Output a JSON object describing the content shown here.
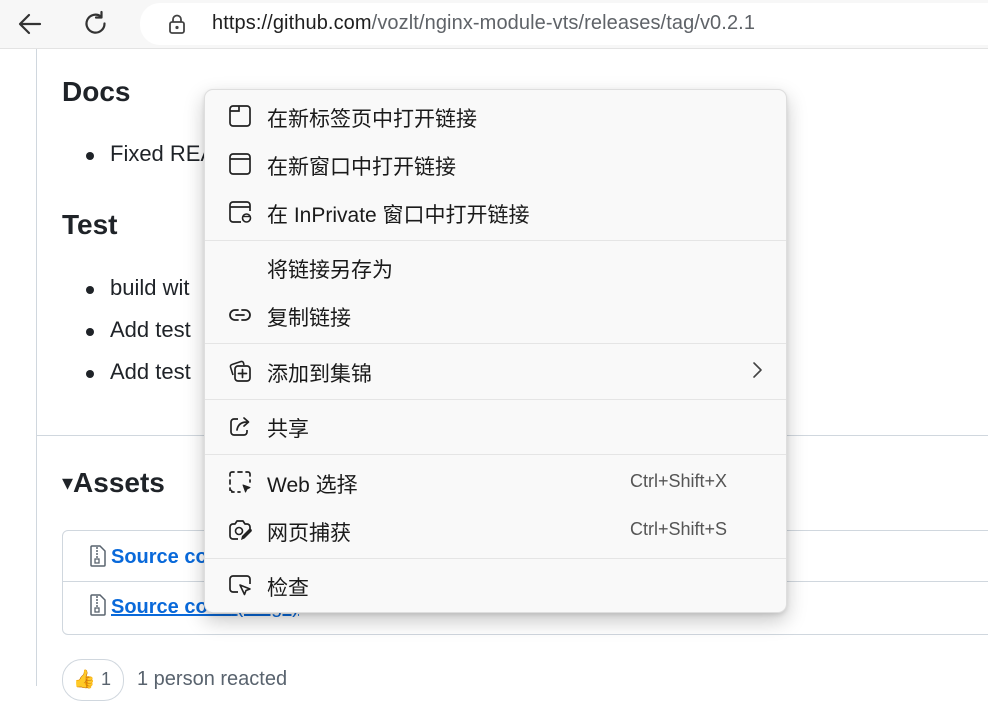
{
  "browser": {
    "url_host": "https://github.com",
    "url_path": "/vozlt/nginx-module-vts/releases/tag/v0.2.1"
  },
  "release": {
    "docs_heading": "Docs",
    "docs_items": [
      "Fixed REA"
    ],
    "test_heading": "Test",
    "test_items": [
      "build wit",
      "Add test",
      "Add test"
    ],
    "assets_heading": "Assets",
    "assets_toggle": "▾",
    "assets": [
      {
        "label": "Source co"
      },
      {
        "label": "Source code",
        "suffix": "(tar.gz)"
      }
    ],
    "reaction_emoji": "👍",
    "reaction_count": "1",
    "reaction_text": "1 person reacted"
  },
  "context_menu": {
    "items": [
      {
        "label": "在新标签页中打开链接",
        "icon": "new-tab-icon"
      },
      {
        "label": "在新窗口中打开链接",
        "icon": "new-window-icon"
      },
      {
        "label": "在 InPrivate 窗口中打开链接",
        "icon": "inprivate-window-icon"
      },
      {
        "label": "将链接另存为",
        "icon": ""
      },
      {
        "label": "复制链接",
        "icon": "link-icon"
      },
      {
        "label": "添加到集锦",
        "icon": "collections-add-icon",
        "submenu": true
      },
      {
        "label": "共享",
        "icon": "share-icon"
      },
      {
        "label": "Web 选择",
        "icon": "web-select-icon",
        "shortcut": "Ctrl+Shift+X"
      },
      {
        "label": "网页捕获",
        "icon": "web-capture-icon",
        "shortcut": "Ctrl+Shift+S"
      },
      {
        "label": "检查",
        "icon": "inspect-icon"
      }
    ]
  },
  "colors": {
    "link": "#0969da",
    "menu_bg": "#f9f9f9",
    "text": "#1f2328"
  }
}
